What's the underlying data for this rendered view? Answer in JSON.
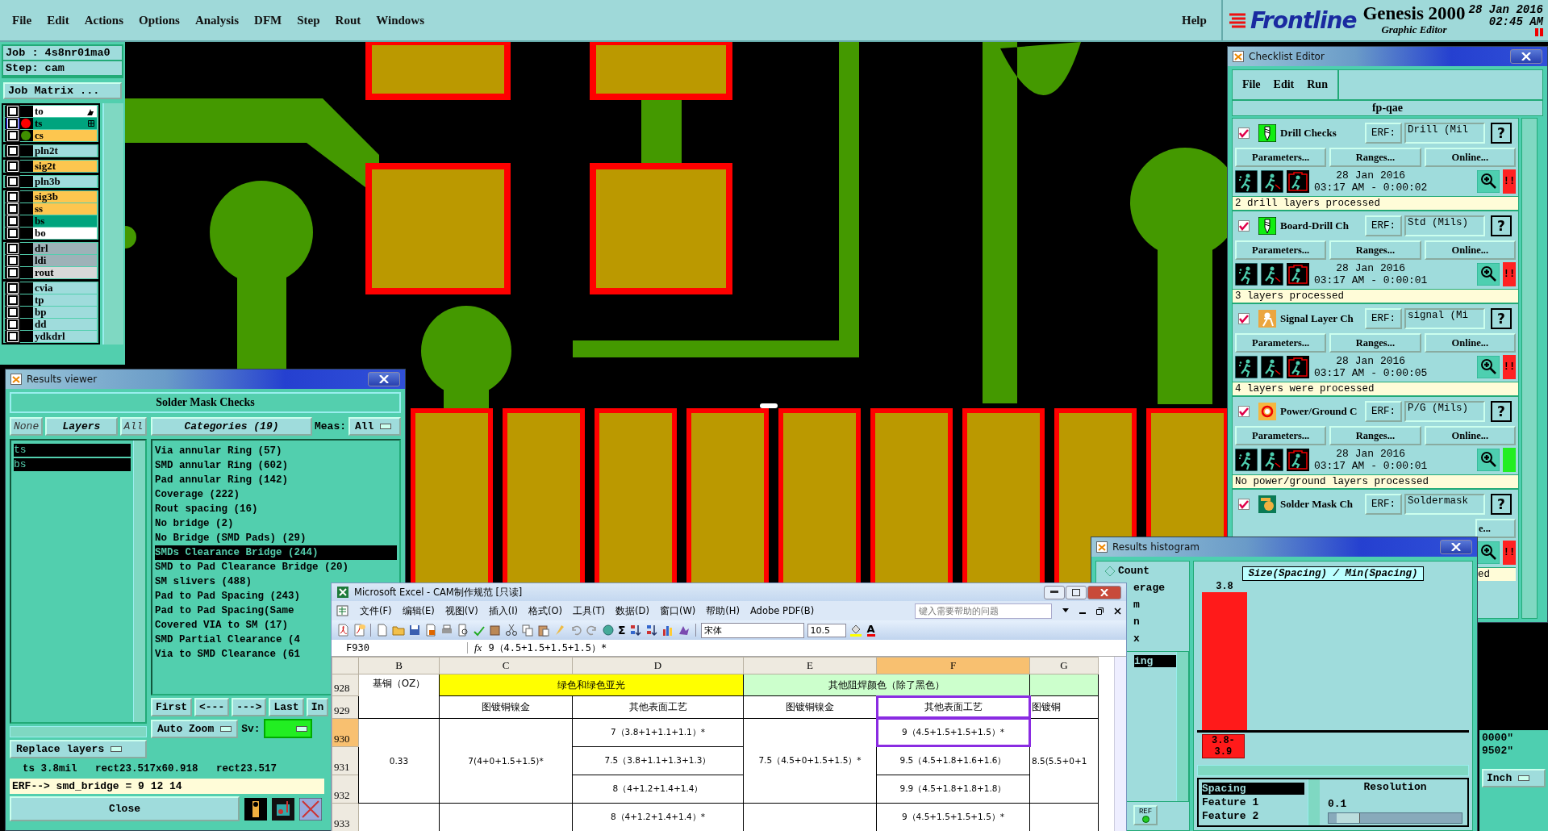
{
  "menu_bar": {
    "items": [
      "File",
      "Edit",
      "Actions",
      "Options",
      "Analysis",
      "DFM",
      "Step",
      "Rout",
      "Windows"
    ],
    "help": "Help"
  },
  "brand": {
    "logo": "Frontline",
    "product": "Genesis 2000",
    "subtitle": "Graphic Editor",
    "date": "28 Jan 2016",
    "time": "02:45 AM"
  },
  "job_panel": {
    "job": "Job : 4s8nr01ma0",
    "step": "Step: cam",
    "matrix_button": "Job Matrix ..."
  },
  "layer_groups": [
    {
      "layers": [
        {
          "name": "to",
          "color": "#ffffff",
          "checked": false,
          "focused": false
        },
        {
          "name": "ts",
          "color": "#00a47e",
          "checked": false,
          "focused": true,
          "display": {
            "color": "#ff0000"
          }
        },
        {
          "name": "cs",
          "color": "#fdc64f",
          "checked": false,
          "focused": false,
          "display": {
            "color": "#3f8f00"
          }
        }
      ]
    },
    {
      "layers": [
        {
          "name": "pln2t",
          "color": "#9fdcdc",
          "checked": false,
          "focused": false
        }
      ]
    },
    {
      "layers": [
        {
          "name": "sig2t",
          "color": "#fdc64f",
          "checked": false,
          "focused": false
        }
      ]
    },
    {
      "layers": [
        {
          "name": "pln3b",
          "color": "#9fdcdc",
          "checked": false,
          "focused": false
        }
      ]
    },
    {
      "layers": [
        {
          "name": "sig3b",
          "color": "#fdc64f",
          "checked": false,
          "focused": false
        },
        {
          "name": "ss",
          "color": "#fdc64f",
          "checked": false,
          "focused": false
        },
        {
          "name": "bs",
          "color": "#00a47e",
          "checked": false,
          "focused": false
        },
        {
          "name": "bo",
          "color": "#ffffff",
          "checked": false,
          "focused": false
        }
      ]
    },
    {
      "layers": [
        {
          "name": "drl",
          "color": "#9eb2b8",
          "checked": false,
          "focused": false
        },
        {
          "name": "ldi",
          "color": "#9eb2b8",
          "checked": false,
          "focused": false
        },
        {
          "name": "rout",
          "color": "#d8d8d8",
          "checked": false,
          "focused": false
        }
      ]
    },
    {
      "layers": [
        {
          "name": "cvia",
          "color": "#9fdcdc",
          "checked": false,
          "focused": false
        },
        {
          "name": "tp",
          "color": "#9fdcdc",
          "checked": false,
          "focused": false
        },
        {
          "name": "bp",
          "color": "#9fdcdc",
          "checked": false,
          "focused": false
        },
        {
          "name": "dd",
          "color": "#9fdcdc",
          "checked": false,
          "focused": false
        },
        {
          "name": "ydkdrl",
          "color": "#9fdcdc",
          "checked": false,
          "focused": false
        }
      ]
    }
  ],
  "results_viewer": {
    "title": "Results viewer",
    "heading": "Solder Mask Checks",
    "layer_buttons": [
      {
        "label": "None",
        "selected": false
      },
      {
        "label": "Layers",
        "selected": true
      },
      {
        "label": "All",
        "selected": false
      }
    ],
    "layers": [
      {
        "name": "ts",
        "selected": true
      },
      {
        "name": "bs",
        "selected": true
      }
    ],
    "categories_button": "Categories (19)",
    "meas_label": "Meas:",
    "meas_value": "All",
    "categories": [
      {
        "label": "Via annular Ring (57)",
        "selected": false
      },
      {
        "label": "SMD annular Ring (602)",
        "selected": false
      },
      {
        "label": "Pad annular Ring (142)",
        "selected": false
      },
      {
        "label": "Coverage (222)",
        "selected": false
      },
      {
        "label": "Rout spacing (16)",
        "selected": false
      },
      {
        "label": "No bridge (2)",
        "selected": false
      },
      {
        "label": "No Bridge (SMD Pads) (29)",
        "selected": false
      },
      {
        "label": "SMDs Clearance Bridge (244)",
        "selected": true
      },
      {
        "label": "SMD to Pad Clearance Bridge (20)",
        "selected": false
      },
      {
        "label": "SM slivers (488)",
        "selected": false
      },
      {
        "label": "Pad to Pad Spacing (243)",
        "selected": false
      },
      {
        "label": "Pad to Pad Spacing(Same",
        "selected": false
      },
      {
        "label": "Covered VIA to SM (17)",
        "selected": false
      },
      {
        "label": "SMD Partial Clearance (4",
        "selected": false
      },
      {
        "label": "Via to SMD Clearance (61",
        "selected": false
      }
    ],
    "nav_buttons": [
      "First",
      "<---",
      "--->",
      "Last",
      "In"
    ],
    "zoom_mode": "Auto Zoom",
    "sv_label": "Sv:",
    "replace_mode": "Replace layers",
    "measure_line": "ts 3.8mil   rect23.517x60.918   rect23.517",
    "erf_line": "ERF--> smd_bridge = 9 12 14",
    "close_button": "Close"
  },
  "excel": {
    "title": "Microsoft Excel - CAM制作规范  [只读]",
    "menus": [
      "文件(F)",
      "编辑(E)",
      "视图(V)",
      "插入(I)",
      "格式(O)",
      "工具(T)",
      "数据(D)",
      "窗口(W)",
      "帮助(H)",
      "Adobe PDF(B)"
    ],
    "help_placeholder": "键入需要帮助的问题",
    "sum_symbol": "Σ",
    "font_name": "宋体",
    "font_size": "10.5",
    "font_color_label": "A",
    "name_box": "F930",
    "fx_label": "fx",
    "formula": "9（4.5+1.5+1.5+1.5）*",
    "columns": [
      {
        "label": "B",
        "selected": false
      },
      {
        "label": "C",
        "selected": false
      },
      {
        "label": "D",
        "selected": false
      },
      {
        "label": "E",
        "selected": false
      },
      {
        "label": "F",
        "selected": true
      },
      {
        "label": "G",
        "selected": false
      }
    ],
    "rows": [
      {
        "label": "928",
        "selected": false,
        "b": "基铜（OZ）",
        "cd": "绿色和绿色亚光",
        "ef": "其他阻焊颜色（除了黑色）"
      },
      {
        "label": "929",
        "selected": false,
        "c": "图镀铜镍金",
        "d": "其他表面工艺",
        "e": "图镀铜镍金",
        "f": "其他表面工艺",
        "g": "图镀铜"
      },
      {
        "label": "930",
        "selected": true,
        "b": "0.33",
        "c": "7(4+0+1.5+1.5)*",
        "d": "7（3.8+1+1.1+1.1）*",
        "e": "7.5（4.5+0+1.5+1.5）*",
        "f": "9（4.5+1.5+1.5+1.5）*",
        "g": "8.5(5.5+0+1"
      },
      {
        "label": "931",
        "selected": false,
        "d": "7.5（3.8+1.1+1.3+1.3）",
        "f": "9.5（4.5+1.8+1.6+1.6）"
      },
      {
        "label": "932",
        "selected": false,
        "d": "8（4+1.2+1.4+1.4）",
        "f": "9.9（4.5+1.8+1.8+1.8）"
      },
      {
        "label": "933",
        "selected": false,
        "d": "8（4+1.2+1.4+1.4）*",
        "f": "9（4.5+1.5+1.5+1.5）*"
      }
    ]
  },
  "checklist": {
    "title": "Checklist Editor",
    "menus": [
      "File",
      "Edit",
      "Run"
    ],
    "name": "fp-qae",
    "checks": [
      {
        "kind": "full",
        "checked": true,
        "name": "Drill Checks",
        "erf_label": "ERF:",
        "erf": "Drill (Mil",
        "help_label": "?",
        "buttons": [
          "Parameters...",
          "Ranges...",
          "Online..."
        ],
        "date": "28 Jan 2016",
        "time": "03:17 AM - 0:00:02",
        "color": "#ff2222",
        "flag": "!!",
        "message": "2 drill layers processed"
      },
      {
        "kind": "full",
        "checked": true,
        "name": "Board-Drill Ch",
        "erf_label": "ERF:",
        "erf": "Std (Mils)",
        "help_label": "?",
        "buttons": [
          "Parameters...",
          "Ranges...",
          "Online..."
        ],
        "date": "28 Jan 2016",
        "time": "03:17 AM - 0:00:01",
        "color": "#ff2222",
        "flag": "!!",
        "message": "3 layers processed"
      },
      {
        "kind": "full",
        "checked": true,
        "name": "Signal Layer Ch",
        "erf_label": "ERF:",
        "erf": "signal (Mi",
        "help_label": "?",
        "buttons": [
          "Parameters...",
          "Ranges...",
          "Online..."
        ],
        "date": "28 Jan 2016",
        "time": "03:17 AM - 0:00:05",
        "color": "#ff2222",
        "flag": "!!",
        "message": "4 layers were processed"
      },
      {
        "kind": "full",
        "checked": true,
        "name": "Power/Ground C",
        "erf_label": "ERF:",
        "erf": "P/G (Mils)",
        "help_label": "?",
        "buttons": [
          "Parameters...",
          "Ranges...",
          "Online..."
        ],
        "date": "28 Jan 2016",
        "time": "03:17 AM - 0:00:01",
        "color": "#22ee22",
        "message": "No power/ground layers processed"
      },
      {
        "kind": "cut",
        "checked": true,
        "name": "Solder Mask Ch",
        "erf_label": "ERF:",
        "erf": "Soldermask",
        "help_label": "?",
        "buttons": [
          "e..."
        ],
        "color": "#ff2222",
        "flag": "!!",
        "message": "ed"
      }
    ]
  },
  "histogram": {
    "title": "Results histogram",
    "options": [
      "Count",
      "erage",
      "m",
      "n",
      "x"
    ],
    "list": [
      {
        "label": "ing",
        "selected": true
      }
    ],
    "ref_label": "REF",
    "chart_title": "Size(Spacing) / Min(Spacing)",
    "bar_label": "3.8",
    "bin_label": "3.8-3.9",
    "fields": [
      {
        "label": "Spacing",
        "selected": true
      },
      {
        "label": "Feature 1",
        "selected": false
      },
      {
        "label": "Feature 2",
        "selected": false
      }
    ],
    "resolution_label": "Resolution",
    "resolution_value": "0.1",
    "resolution": {
      "level": 0.06
    }
  },
  "coord_panel": {
    "coords": [
      "0000\"",
      "9502\""
    ],
    "units": "Inch"
  }
}
